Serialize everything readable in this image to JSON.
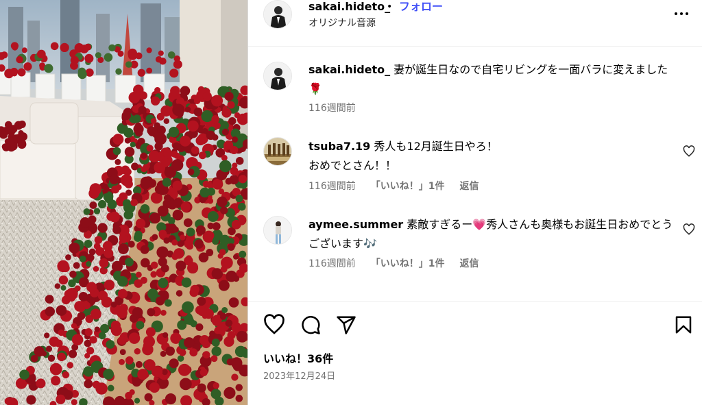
{
  "post": {
    "username": "sakai.hideto_",
    "separator": "•",
    "follow_label": "フォロー",
    "audio_label": "オリジナル音源",
    "caption": {
      "username": "sakai.hideto_",
      "text": "妻が誕生日なので自宅リビングを一面バラに変えました",
      "emoji": "🌹",
      "time": "116週間前"
    }
  },
  "comments": [
    {
      "username": "tsuba7.19",
      "text_line1": "秀人も12月誕生日やろ！",
      "text_line2": "おめでとさん！！",
      "time": "116週間前",
      "likes_label": "「いいね！」1件",
      "reply_label": "返信"
    },
    {
      "username": "aymee.summer",
      "text_part1": "素敵すぎるー",
      "heart_emoji": "💗",
      "text_part2": "秀人さんも奥様もお誕生日おめでとうございます",
      "music_emoji": "🎶",
      "time": "116週間前",
      "likes_label": "「いいね！」1件",
      "reply_label": "返信"
    }
  ],
  "footer": {
    "likes_label": "いいね！36件",
    "date": "2023年12月24日"
  },
  "icons": [
    "more-icon",
    "heart-icon",
    "comment-icon",
    "share-icon",
    "save-icon"
  ],
  "colors": {
    "follow": "#4150f7",
    "muted": "#737373",
    "rose": "#b3121f"
  }
}
